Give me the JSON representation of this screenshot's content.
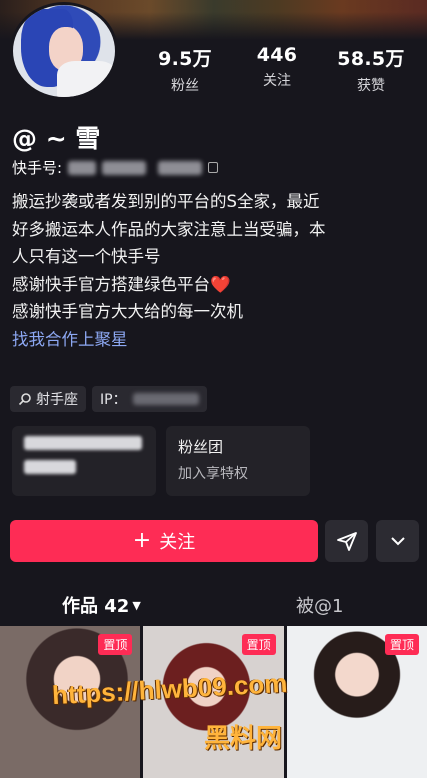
{
  "profile": {
    "display_name": "@ ~ 雪",
    "kuaishou_id_label": "快手号:"
  },
  "stats": [
    {
      "value": "9.5万",
      "label": "粉丝"
    },
    {
      "value": "446",
      "label": "关注"
    },
    {
      "value": "58.5万",
      "label": "获赞"
    }
  ],
  "bio": {
    "line1": "搬运抄袭或者发到别的平台的S全家，最近",
    "line2": "好多搬运本人作品的大家注意上当受骗，本",
    "line3": "人只有这一个快手号",
    "line4": "感谢快手官方搭建绿色平台",
    "line4_emoji": "❤️",
    "line5": "感谢快手官方大大给的每一次机",
    "link": "找我合作上聚星"
  },
  "tags": {
    "zodiac": "射手座",
    "ip_label": "IP："
  },
  "cards": {
    "fans_club_title": "粉丝团",
    "fans_club_sub": "加入享特权"
  },
  "actions": {
    "follow_label": "关注",
    "follow_plus": "+"
  },
  "tabs": {
    "works": "作品 42",
    "mentioned": "被@1"
  },
  "grid": {
    "pin_label": "置顶"
  },
  "watermark": {
    "url": "https://hlwb09.com",
    "site": "黑料网"
  },
  "colors": {
    "accent": "#fe2c55",
    "background": "#17161d",
    "link": "#8da8f3"
  }
}
